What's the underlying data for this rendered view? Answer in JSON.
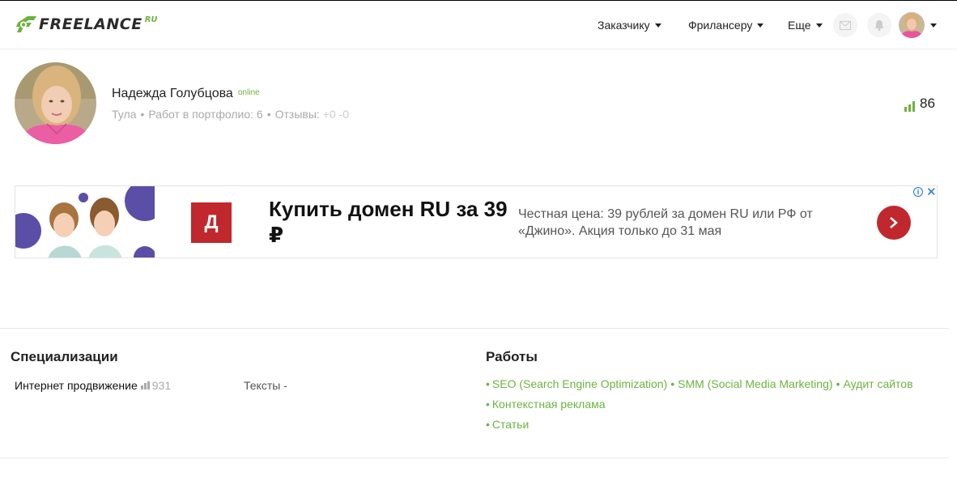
{
  "header": {
    "logo_text": "FREELANCE",
    "logo_suffix": "RU",
    "nav": [
      {
        "label": "Заказчику"
      },
      {
        "label": "Фрилансеру"
      },
      {
        "label": "Еще"
      }
    ],
    "icons": [
      "envelope-icon",
      "bell-icon"
    ]
  },
  "profile": {
    "name": "Надежда Голубцова",
    "status": "online",
    "city": "Тула",
    "portfolio": "Работ в портфолио: 6",
    "reviews_label": "Отзывы:",
    "reviews_value": "+0 -0",
    "rating": "86"
  },
  "ad": {
    "logo_letter": "Д",
    "title": "Купить домен RU за 39 ₽",
    "description": "Честная цена: 39 рублей за домен RU или РФ от «Джино». Акция только до 31 мая",
    "info_glyph": "i",
    "close_glyph": "✕",
    "accent": "#c0282d"
  },
  "specializations": {
    "heading": "Специализации",
    "items": [
      {
        "name": "Интернет продвижение",
        "count": "931"
      }
    ],
    "secondary": "Тексты -"
  },
  "works": {
    "heading": "Работы",
    "line1": [
      "SEO (Search Engine Optimization)",
      "SMM (Social Media Marketing)",
      "Аудит сайтов"
    ],
    "line2": "Контекстная реклама",
    "line3": "Статьи",
    "bullet": "•"
  },
  "colors": {
    "brand_green": "#6cb33f",
    "text": "#222222",
    "muted": "#aaaaaa"
  }
}
